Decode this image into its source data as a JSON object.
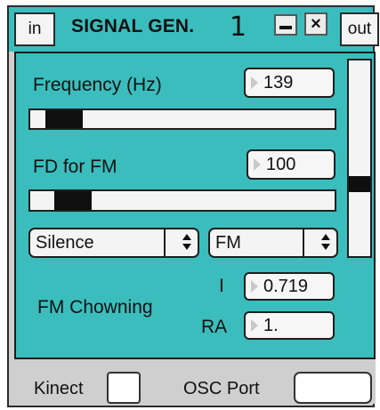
{
  "window": {
    "title": "SIGNAL GEN.",
    "instance": "1",
    "in_label": "in",
    "out_label": "out",
    "minimize_label": "–",
    "close_label": "×"
  },
  "frequency": {
    "label": "Frequency (Hz)",
    "value": "139",
    "slider_level": 0.11
  },
  "fd": {
    "label": "FD for FM",
    "value": "100",
    "slider_level": 0.14
  },
  "vertical_slider": {
    "level": 0.37
  },
  "menus": {
    "left_selected": "Silence",
    "right_selected": "FM"
  },
  "fm_chowning": {
    "label": "FM Chowning",
    "i_label": "I",
    "i_value": "0.719",
    "ra_label": "RA",
    "ra_value": "1."
  },
  "bottom": {
    "kinect_label": "Kinect",
    "osc_label": "OSC Port"
  },
  "colors": {
    "teal": "#3bbdbd",
    "gray": "#cfcfcf"
  },
  "icons": {
    "minimize": "minimize-icon",
    "close": "close-icon",
    "menu_arrows": "updown-arrows-icon"
  }
}
